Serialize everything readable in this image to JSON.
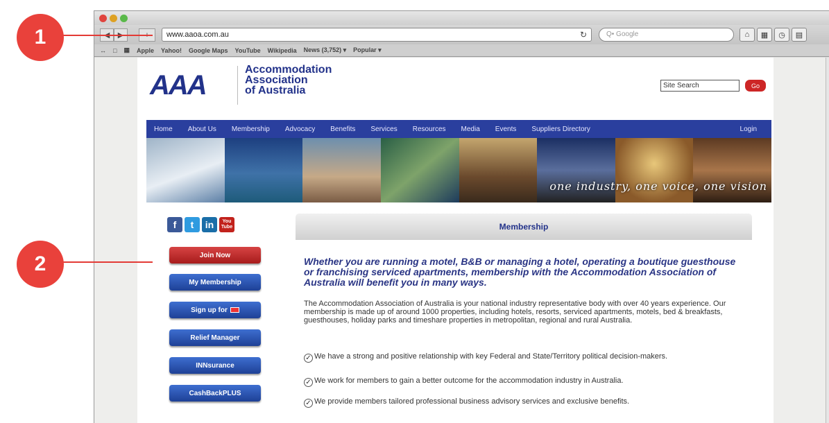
{
  "callouts": [
    {
      "number": "1"
    },
    {
      "number": "2"
    }
  ],
  "browser": {
    "url": "www.aaoa.com.au",
    "search_placeholder": "Q• Google",
    "bookmarks": [
      "Apple",
      "Yahoo!",
      "Google Maps",
      "YouTube",
      "Wikipedia",
      "News (3,752) ▾",
      "Popular ▾"
    ]
  },
  "site": {
    "logo_mark": "AAA",
    "logo_lines": [
      "Accommodation",
      "Association",
      "of Australia"
    ],
    "search_label": "Site Search",
    "go_label": "Go",
    "nav": [
      "Home",
      "About Us",
      "Membership",
      "Advocacy",
      "Benefits",
      "Services",
      "Resources",
      "Media",
      "Events",
      "Suppliers Directory"
    ],
    "login": "Login",
    "banner_tagline": "one industry, one voice, one vision",
    "social": [
      {
        "label": "f",
        "color": "#3b5998"
      },
      {
        "label": "t",
        "color": "#2f9be0"
      },
      {
        "label": "in",
        "color": "#1a6ea8"
      },
      {
        "label": "You Tube",
        "color": "#c2221c"
      }
    ],
    "sidebar_buttons": [
      {
        "label": "Join Now",
        "color": "#c12a2a"
      },
      {
        "label": "My Membership",
        "color": "#2c56b3"
      },
      {
        "label": "Sign up for",
        "color": "#2c56b3"
      },
      {
        "label": "Relief Manager",
        "color": "#2c56b3"
      },
      {
        "label": "INNsurance",
        "color": "#2c56b3"
      },
      {
        "label": "CashBackPLUS",
        "color": "#2c56b3"
      }
    ],
    "panel_title": "Membership",
    "intro": "Whether you are running a motel, B&B or managing a hotel, operating a boutique guesthouse or franchising serviced apartments, membership with the Accommodation Association of Australia will benefit you in many ways.",
    "body": "The Accommodation Association of Australia is your national industry representative body with over 40 years experience. Our membership is made up of around 1000 properties, including hotels, resorts, serviced apartments, motels, bed & breakfasts, guesthouses, holiday parks and timeshare properties in metropolitan, regional and rural Australia.",
    "checks": [
      "We have a strong and positive relationship with key Federal and State/Territory political decision-makers.",
      "We work for members to gain a better outcome for the accommodation industry in Australia.",
      "We provide members tailored professional business advisory services and exclusive benefits."
    ]
  }
}
